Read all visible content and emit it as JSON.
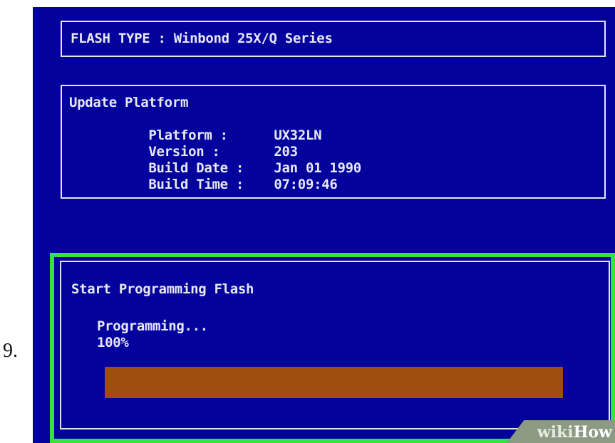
{
  "step_number": "9.",
  "colors": {
    "screen_background": "#03029c",
    "text": "#e8e8f2",
    "highlight_border": "#36e23c",
    "progress_bar": "#a04d10"
  },
  "flash": {
    "text": "FLASH TYPE : Winbond 25X/Q Series"
  },
  "platform": {
    "heading": "Update Platform",
    "rows": [
      {
        "label": "Platform :",
        "value": "UX32LN"
      },
      {
        "label": "Version :",
        "value": "203"
      },
      {
        "label": "Build Date :",
        "value": "Jan 01 1990"
      },
      {
        "label": "Build Time :",
        "value": "07:09:46"
      }
    ]
  },
  "programming": {
    "title": "Start Programming Flash",
    "status": "Programming...",
    "percent_text": "100%",
    "progress_fraction": 1.0
  },
  "watermark": {
    "part1": "wiki",
    "part2": "How"
  }
}
